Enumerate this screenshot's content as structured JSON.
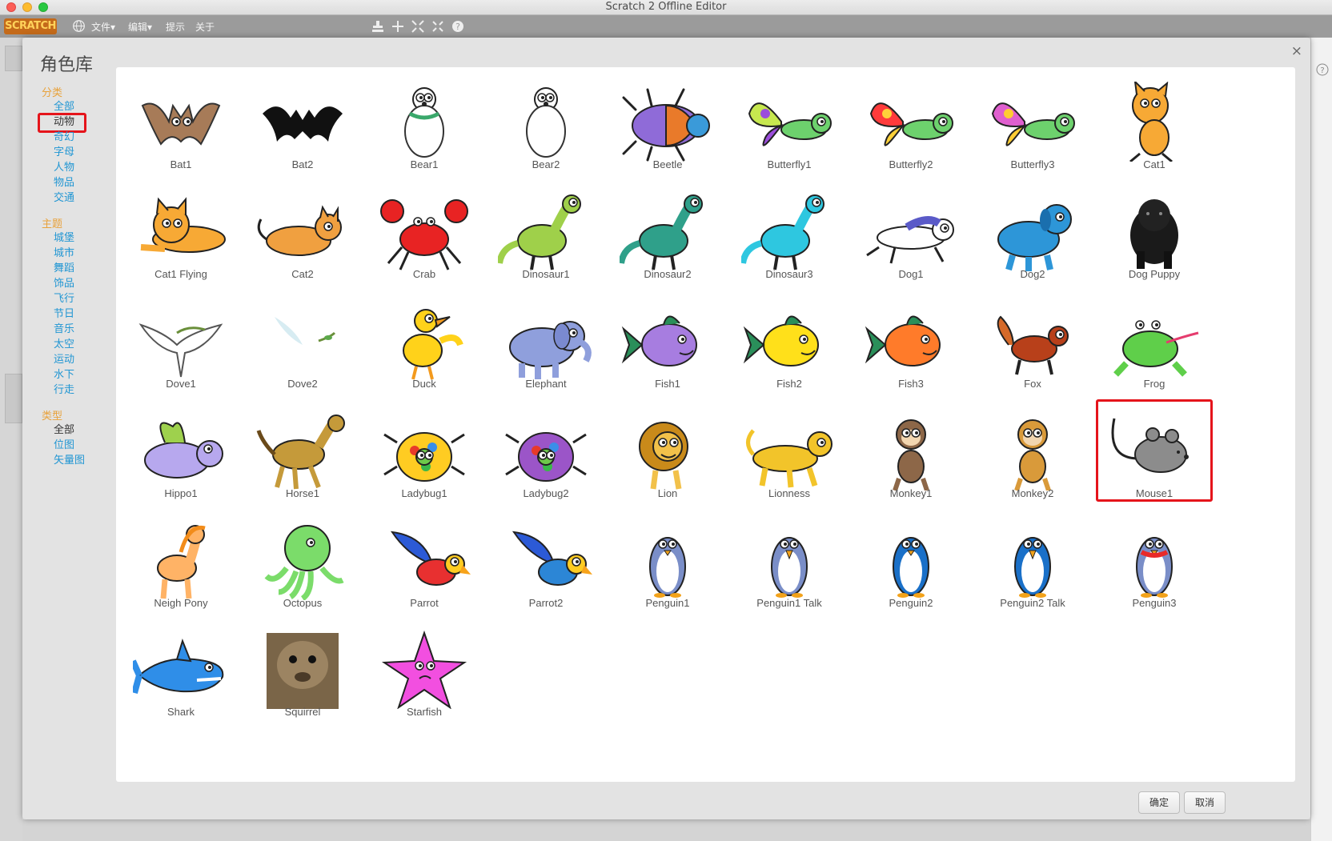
{
  "window": {
    "title": "Scratch 2 Offline Editor"
  },
  "menubar": {
    "logo": "SCRATCH",
    "items": [
      "文件▾",
      "编辑▾",
      "提示",
      "关于"
    ]
  },
  "dialog": {
    "title": "角色库",
    "close_label": "×",
    "sections": [
      {
        "heading": "分类",
        "items": [
          "全部",
          "动物",
          "奇幻",
          "字母",
          "人物",
          "物品",
          "交通"
        ],
        "selected": "动物"
      },
      {
        "heading": "主题",
        "items": [
          "城堡",
          "城市",
          "舞蹈",
          "饰品",
          "飞行",
          "节日",
          "音乐",
          "太空",
          "运动",
          "水下",
          "行走"
        ]
      },
      {
        "heading": "类型",
        "items": [
          "全部",
          "位图",
          "矢量图"
        ],
        "selected": "全部"
      }
    ],
    "sprites": [
      "Bat1",
      "Bat2",
      "Bear1",
      "Bear2",
      "Beetle",
      "Butterfly1",
      "Butterfly2",
      "Butterfly3",
      "Cat1",
      "Cat1 Flying",
      "Cat2",
      "Crab",
      "Dinosaur1",
      "Dinosaur2",
      "Dinosaur3",
      "Dog1",
      "Dog2",
      "Dog Puppy",
      "Dove1",
      "Dove2",
      "Duck",
      "Elephant",
      "Fish1",
      "Fish2",
      "Fish3",
      "Fox",
      "Frog",
      "Hippo1",
      "Horse1",
      "Ladybug1",
      "Ladybug2",
      "Lion",
      "Lionness",
      "Monkey1",
      "Monkey2",
      "Mouse1",
      "Neigh Pony",
      "Octopus",
      "Parrot",
      "Parrot2",
      "Penguin1",
      "Penguin1 Talk",
      "Penguin2",
      "Penguin2 Talk",
      "Penguin3",
      "Shark",
      "Squirrel",
      "Starfish"
    ],
    "selected_sprite": "Mouse1",
    "ok_label": "确定",
    "cancel_label": "取消"
  },
  "colors": {
    "accent": "#2196d3",
    "heading": "#e8a23b",
    "highlight": "#e5141b"
  }
}
